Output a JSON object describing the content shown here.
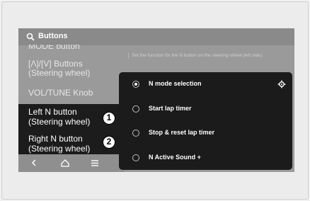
{
  "header": {
    "title": "Buttons",
    "search_icon": "search-icon"
  },
  "menu": {
    "items": [
      {
        "label": "MODE button"
      },
      {
        "label": "[Λ]/[V] Buttons",
        "sub": "(Steering wheel)"
      },
      {
        "label": "VOL/TUNE Knob"
      },
      {
        "label": "Left N button",
        "sub": "(Steering wheel)",
        "badge": "1"
      },
      {
        "label": "Right N button",
        "sub": "(Steering wheel)",
        "badge": "2"
      }
    ]
  },
  "description": "Set the function for the N button on the steering wheel (left side).",
  "options": [
    {
      "label": "N mode selection",
      "selected": true
    },
    {
      "label": "Start lap timer",
      "selected": false
    },
    {
      "label": "Stop & reset lap timer",
      "selected": false
    },
    {
      "label": "N Active Sound +",
      "selected": false
    }
  ],
  "bottom_nav": {
    "icons": [
      "back-icon",
      "home-icon",
      "menu-icon"
    ]
  },
  "settings_icon": "gear-icon"
}
